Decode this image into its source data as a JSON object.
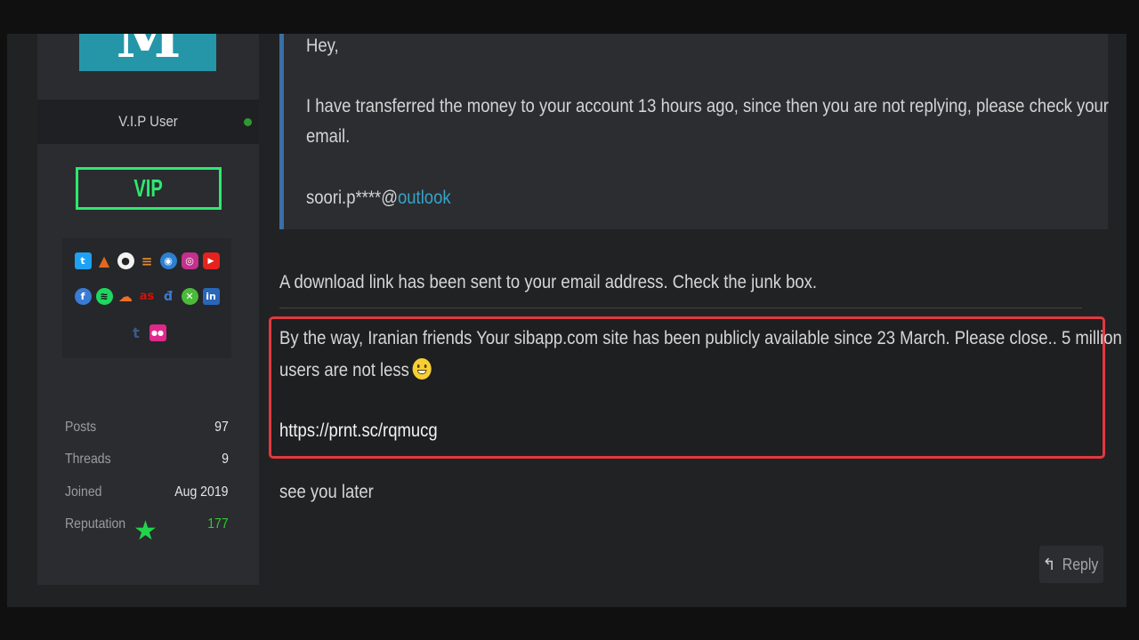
{
  "sidebar": {
    "avatar_letter": "M",
    "user_title": "V.I.P User",
    "badge": "VIP",
    "social_icons": [
      [
        "twitter-icon",
        "archlinux-icon",
        "github-icon",
        "stackoverflow-icon",
        "steam-icon",
        "instagram-icon",
        "youtube-icon"
      ],
      [
        "facebook-icon",
        "spotify-icon",
        "soundcloud-icon",
        "lastfm-icon",
        "deviantart-icon",
        "xbox-icon",
        "linkedin-icon"
      ],
      [
        "tumblr-icon",
        "flickr-icon"
      ]
    ],
    "stats": [
      {
        "label": "Posts",
        "value": "97"
      },
      {
        "label": "Threads",
        "value": "9"
      },
      {
        "label": "Joined",
        "value": "Aug 2019"
      },
      {
        "label": "Reputation",
        "value": "177"
      }
    ]
  },
  "quote": {
    "line1": "Hey,",
    "line2": "I have transferred the money to your account 13 hours ago, since then you are not replying, please check your",
    "line3": "email.",
    "email_prefix": "soori.p****@",
    "email_link": "outlook"
  },
  "post": {
    "reply_text": "A download link has been sent to your email address. Check the junk box.",
    "highlight_line1": "By the way, Iranian friends Your sibapp.com site has been publicly available since 23 March. Please close.. 5 million",
    "highlight_line2": "users are not less",
    "link": "https://prnt.sc/rqmucg",
    "closing": "see you later"
  },
  "actions": {
    "reply_label": "Reply"
  },
  "colors": {
    "vip_green": "#2ee86e",
    "highlight_red": "#e0393f",
    "link_blue": "#35a4c7"
  }
}
